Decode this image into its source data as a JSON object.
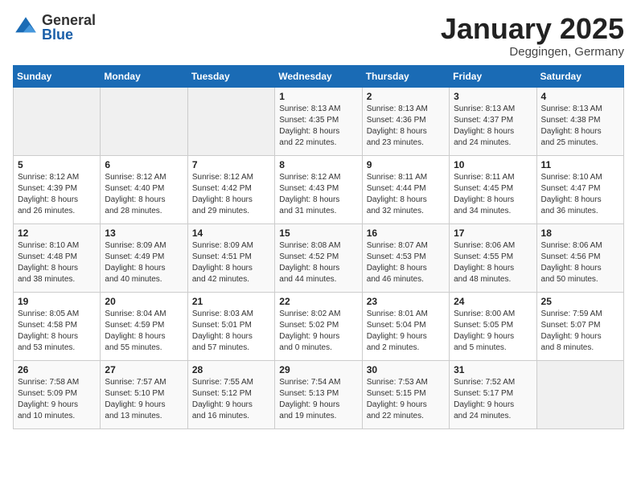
{
  "header": {
    "logo_general": "General",
    "logo_blue": "Blue",
    "month_title": "January 2025",
    "location": "Deggingen, Germany"
  },
  "days_of_week": [
    "Sunday",
    "Monday",
    "Tuesday",
    "Wednesday",
    "Thursday",
    "Friday",
    "Saturday"
  ],
  "weeks": [
    [
      {
        "day": "",
        "content": ""
      },
      {
        "day": "",
        "content": ""
      },
      {
        "day": "",
        "content": ""
      },
      {
        "day": "1",
        "content": "Sunrise: 8:13 AM\nSunset: 4:35 PM\nDaylight: 8 hours\nand 22 minutes."
      },
      {
        "day": "2",
        "content": "Sunrise: 8:13 AM\nSunset: 4:36 PM\nDaylight: 8 hours\nand 23 minutes."
      },
      {
        "day": "3",
        "content": "Sunrise: 8:13 AM\nSunset: 4:37 PM\nDaylight: 8 hours\nand 24 minutes."
      },
      {
        "day": "4",
        "content": "Sunrise: 8:13 AM\nSunset: 4:38 PM\nDaylight: 8 hours\nand 25 minutes."
      }
    ],
    [
      {
        "day": "5",
        "content": "Sunrise: 8:12 AM\nSunset: 4:39 PM\nDaylight: 8 hours\nand 26 minutes."
      },
      {
        "day": "6",
        "content": "Sunrise: 8:12 AM\nSunset: 4:40 PM\nDaylight: 8 hours\nand 28 minutes."
      },
      {
        "day": "7",
        "content": "Sunrise: 8:12 AM\nSunset: 4:42 PM\nDaylight: 8 hours\nand 29 minutes."
      },
      {
        "day": "8",
        "content": "Sunrise: 8:12 AM\nSunset: 4:43 PM\nDaylight: 8 hours\nand 31 minutes."
      },
      {
        "day": "9",
        "content": "Sunrise: 8:11 AM\nSunset: 4:44 PM\nDaylight: 8 hours\nand 32 minutes."
      },
      {
        "day": "10",
        "content": "Sunrise: 8:11 AM\nSunset: 4:45 PM\nDaylight: 8 hours\nand 34 minutes."
      },
      {
        "day": "11",
        "content": "Sunrise: 8:10 AM\nSunset: 4:47 PM\nDaylight: 8 hours\nand 36 minutes."
      }
    ],
    [
      {
        "day": "12",
        "content": "Sunrise: 8:10 AM\nSunset: 4:48 PM\nDaylight: 8 hours\nand 38 minutes."
      },
      {
        "day": "13",
        "content": "Sunrise: 8:09 AM\nSunset: 4:49 PM\nDaylight: 8 hours\nand 40 minutes."
      },
      {
        "day": "14",
        "content": "Sunrise: 8:09 AM\nSunset: 4:51 PM\nDaylight: 8 hours\nand 42 minutes."
      },
      {
        "day": "15",
        "content": "Sunrise: 8:08 AM\nSunset: 4:52 PM\nDaylight: 8 hours\nand 44 minutes."
      },
      {
        "day": "16",
        "content": "Sunrise: 8:07 AM\nSunset: 4:53 PM\nDaylight: 8 hours\nand 46 minutes."
      },
      {
        "day": "17",
        "content": "Sunrise: 8:06 AM\nSunset: 4:55 PM\nDaylight: 8 hours\nand 48 minutes."
      },
      {
        "day": "18",
        "content": "Sunrise: 8:06 AM\nSunset: 4:56 PM\nDaylight: 8 hours\nand 50 minutes."
      }
    ],
    [
      {
        "day": "19",
        "content": "Sunrise: 8:05 AM\nSunset: 4:58 PM\nDaylight: 8 hours\nand 53 minutes."
      },
      {
        "day": "20",
        "content": "Sunrise: 8:04 AM\nSunset: 4:59 PM\nDaylight: 8 hours\nand 55 minutes."
      },
      {
        "day": "21",
        "content": "Sunrise: 8:03 AM\nSunset: 5:01 PM\nDaylight: 8 hours\nand 57 minutes."
      },
      {
        "day": "22",
        "content": "Sunrise: 8:02 AM\nSunset: 5:02 PM\nDaylight: 9 hours\nand 0 minutes."
      },
      {
        "day": "23",
        "content": "Sunrise: 8:01 AM\nSunset: 5:04 PM\nDaylight: 9 hours\nand 2 minutes."
      },
      {
        "day": "24",
        "content": "Sunrise: 8:00 AM\nSunset: 5:05 PM\nDaylight: 9 hours\nand 5 minutes."
      },
      {
        "day": "25",
        "content": "Sunrise: 7:59 AM\nSunset: 5:07 PM\nDaylight: 9 hours\nand 8 minutes."
      }
    ],
    [
      {
        "day": "26",
        "content": "Sunrise: 7:58 AM\nSunset: 5:09 PM\nDaylight: 9 hours\nand 10 minutes."
      },
      {
        "day": "27",
        "content": "Sunrise: 7:57 AM\nSunset: 5:10 PM\nDaylight: 9 hours\nand 13 minutes."
      },
      {
        "day": "28",
        "content": "Sunrise: 7:55 AM\nSunset: 5:12 PM\nDaylight: 9 hours\nand 16 minutes."
      },
      {
        "day": "29",
        "content": "Sunrise: 7:54 AM\nSunset: 5:13 PM\nDaylight: 9 hours\nand 19 minutes."
      },
      {
        "day": "30",
        "content": "Sunrise: 7:53 AM\nSunset: 5:15 PM\nDaylight: 9 hours\nand 22 minutes."
      },
      {
        "day": "31",
        "content": "Sunrise: 7:52 AM\nSunset: 5:17 PM\nDaylight: 9 hours\nand 24 minutes."
      },
      {
        "day": "",
        "content": ""
      }
    ]
  ]
}
